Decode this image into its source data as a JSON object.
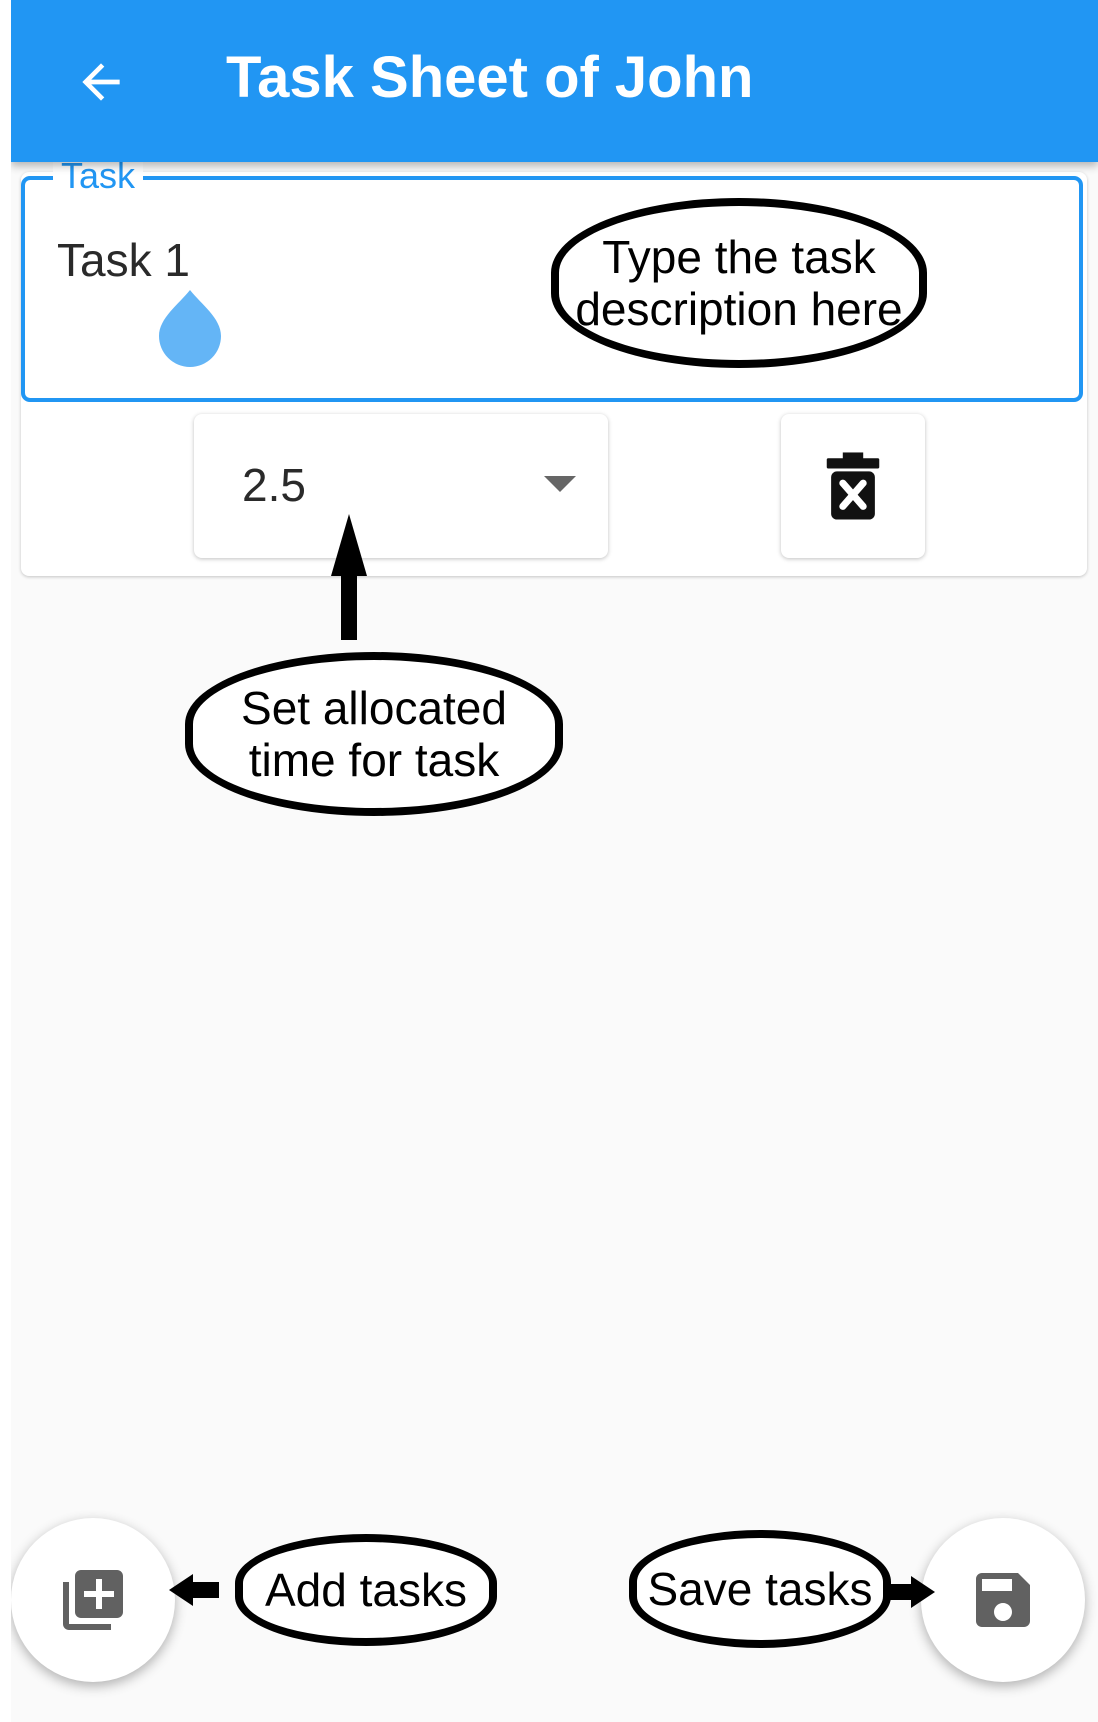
{
  "appbar": {
    "title": "Task Sheet of John",
    "back_icon": "arrow-back-icon",
    "color": "#2196F3"
  },
  "task_card": {
    "field_label": "Task",
    "field_value": "Task 1",
    "hours_value": "2.5",
    "dropdown_icon": "dropdown-arrow-icon",
    "delete_icon": "delete-forever-icon"
  },
  "fabs": {
    "add_icon": "library-add-icon",
    "save_icon": "save-icon"
  },
  "annotations": {
    "description": [
      "Type the task",
      "description here"
    ],
    "time": [
      "Set allocated",
      "time for task"
    ],
    "add": "Add tasks",
    "save": "Save tasks"
  },
  "colors": {
    "accent": "#2196F3",
    "background": "#FAFAFA",
    "icon_gray": "#616161"
  }
}
